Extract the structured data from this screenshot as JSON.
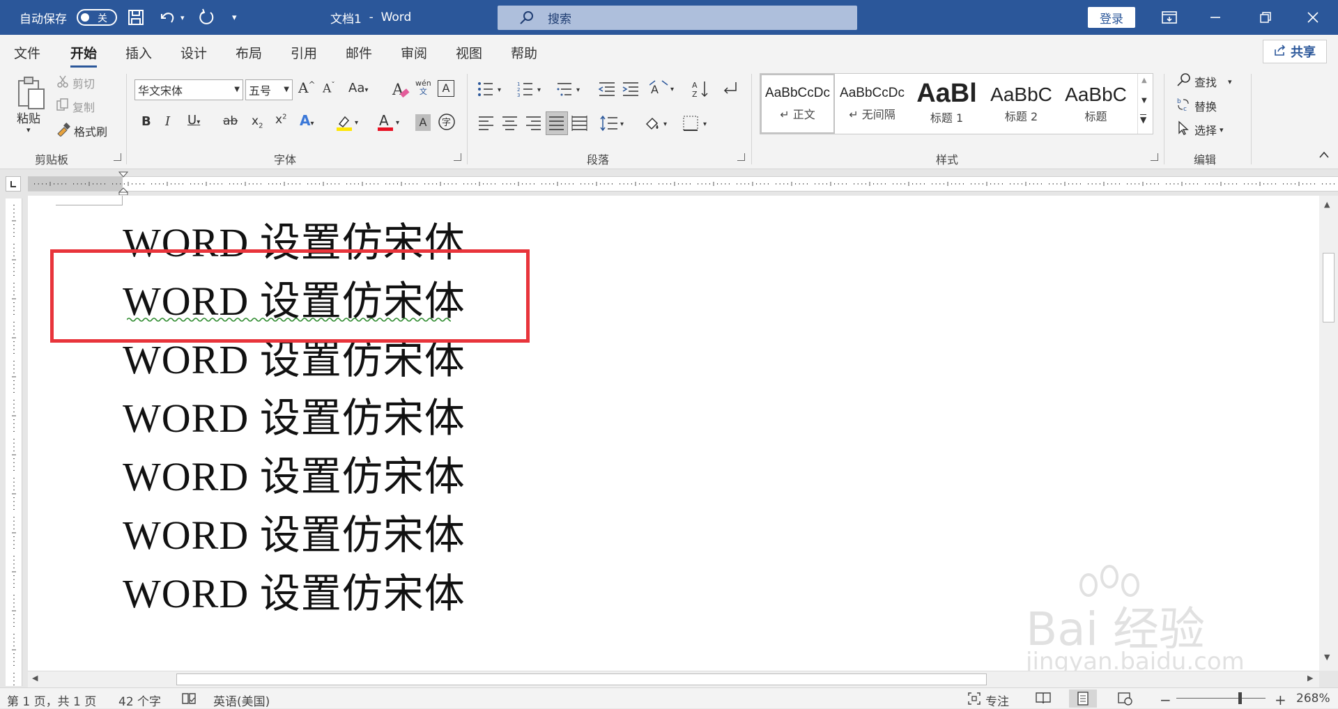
{
  "titlebar": {
    "autosave_label": "自动保存",
    "autosave_state": "关",
    "doc_title": "文档1",
    "separator": "-",
    "app_name": "Word",
    "search_placeholder": "搜索",
    "login_label": "登录"
  },
  "tabs": [
    {
      "label": "文件"
    },
    {
      "label": "开始"
    },
    {
      "label": "插入"
    },
    {
      "label": "设计"
    },
    {
      "label": "布局"
    },
    {
      "label": "引用"
    },
    {
      "label": "邮件"
    },
    {
      "label": "审阅"
    },
    {
      "label": "视图"
    },
    {
      "label": "帮助"
    }
  ],
  "active_tab": "开始",
  "share_label": "共享",
  "clipboard": {
    "paste": "粘贴",
    "cut": "剪切",
    "copy": "复制",
    "format_painter": "格式刷",
    "group_label": "剪贴板"
  },
  "font": {
    "font_name": "华文宋体",
    "font_size": "五号",
    "group_label": "字体",
    "pinyin_top": "wén",
    "pinyin_bottom": "文"
  },
  "paragraph": {
    "group_label": "段落"
  },
  "styles": {
    "group_label": "样式",
    "items": [
      {
        "preview": "AaBbCcDc",
        "name": "↵ 正文"
      },
      {
        "preview": "AaBbCcDc",
        "name": "↵ 无间隔"
      },
      {
        "preview": "AaBl",
        "name": "标题 1"
      },
      {
        "preview": "AaBbC",
        "name": "标题 2"
      },
      {
        "preview": "AaBbC",
        "name": "标题"
      }
    ]
  },
  "editing": {
    "find": "查找",
    "replace": "替换",
    "select": "选择",
    "group_label": "编辑"
  },
  "document": {
    "lines": [
      "WORD 设置仿宋体",
      "WORD 设置仿宋体",
      "WORD 设置仿宋体",
      "WORD 设置仿宋体",
      "WORD 设置仿宋体",
      "WORD 设置仿宋体",
      "WORD 设置仿宋体"
    ]
  },
  "statusbar": {
    "page_info": "第 1 页，共 1 页",
    "word_count": "42 个字",
    "language": "英语(美国)",
    "focus": "专注",
    "zoom_minus": "−",
    "zoom_plus": "+",
    "zoom_level": "268%"
  },
  "watermark": {
    "brand": "Bai 经验",
    "url": "jingyan.baidu.com"
  },
  "colors": {
    "title_bar": "#2b579a",
    "highlight_box": "#e8343b",
    "font_color": "#e81123",
    "highlighter": "#ffe600",
    "squiggle": "#2e8b2e"
  }
}
